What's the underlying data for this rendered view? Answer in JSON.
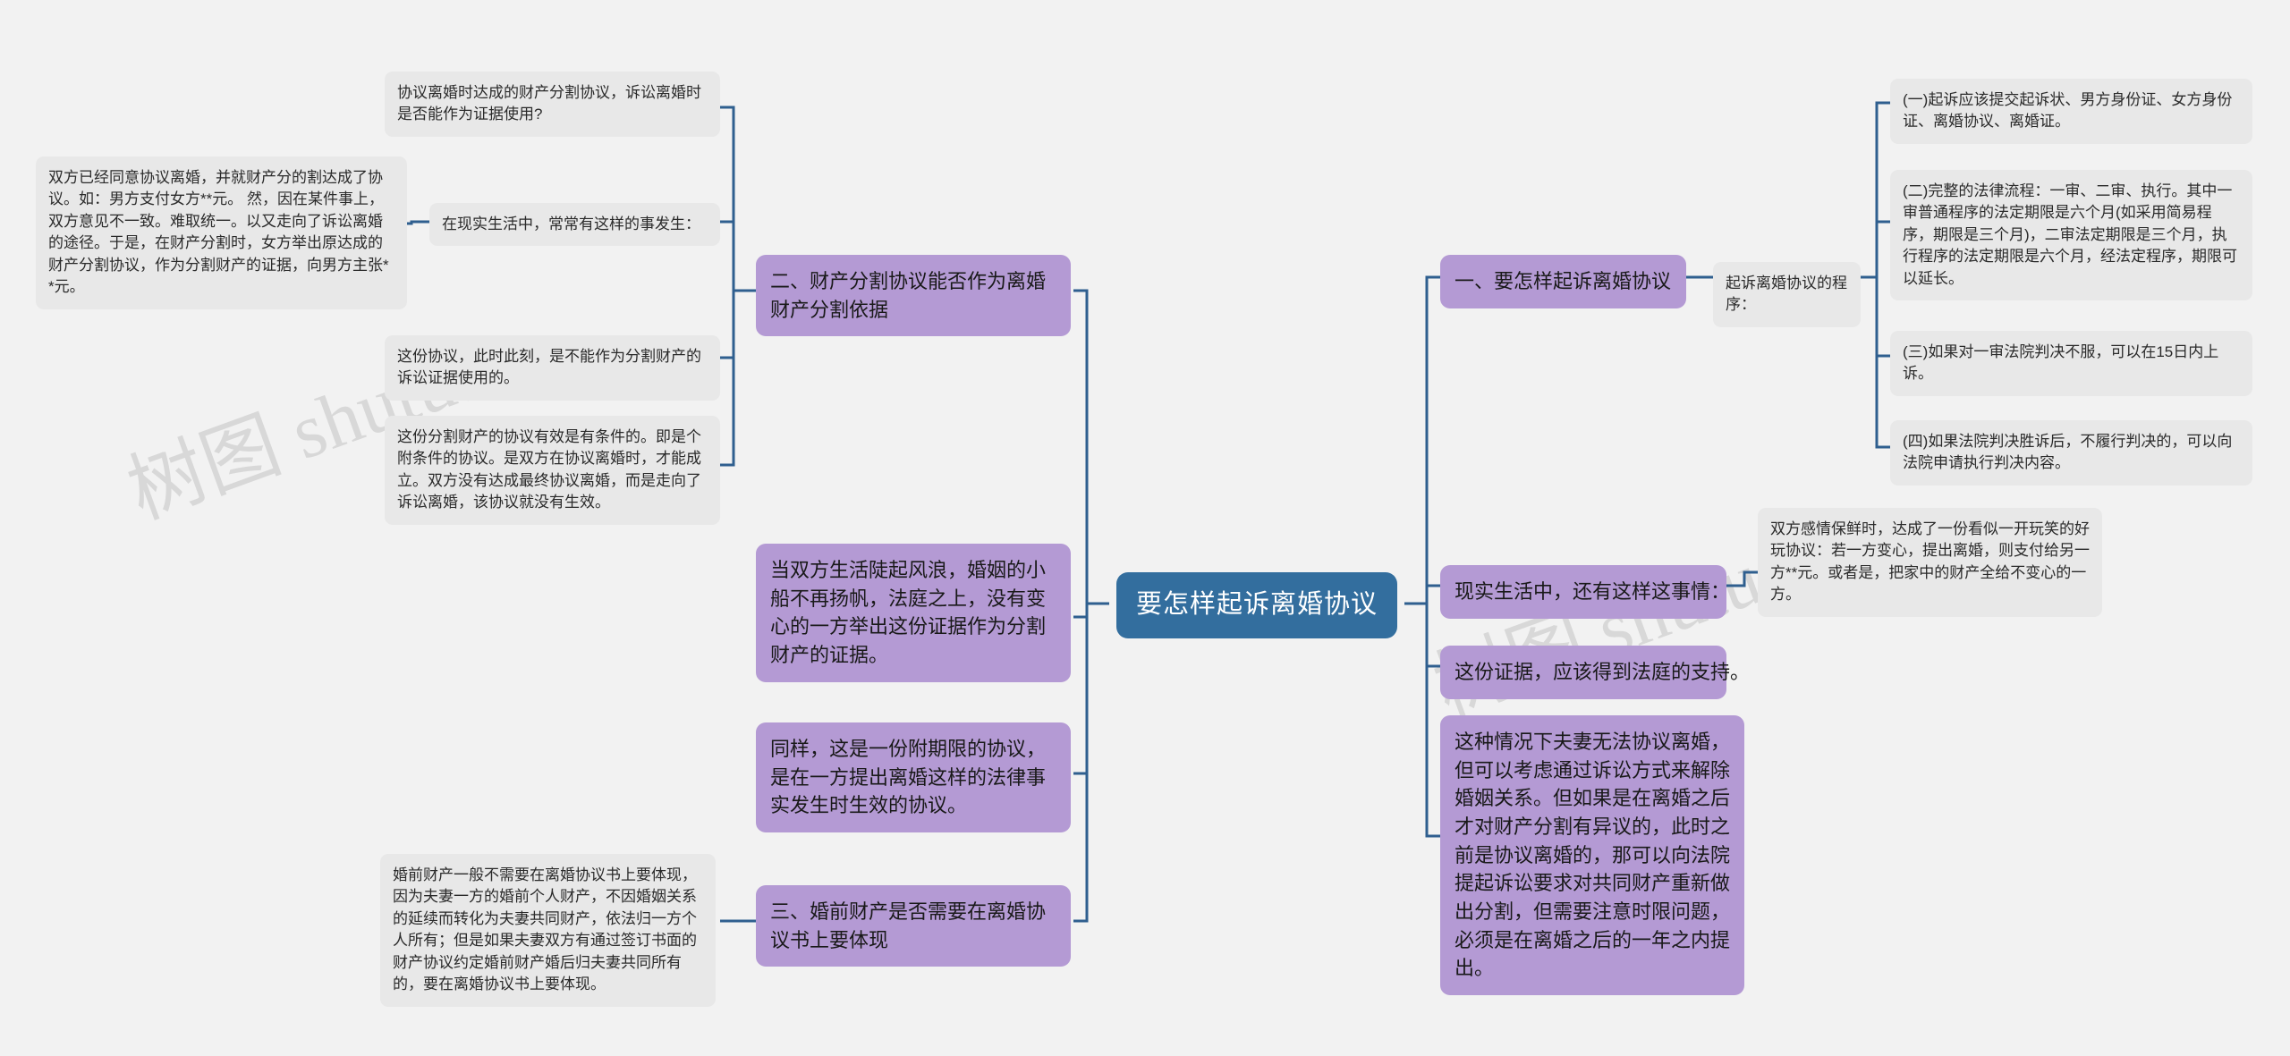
{
  "document": {
    "type": "mindmap",
    "title": "要怎样起诉离婚协议",
    "watermarks": [
      "树图 shutu.cn",
      "树图 shutu.cn"
    ],
    "colors": {
      "background": "#f2f2f2",
      "root_node": "#336e9e",
      "root_text": "#ffffff",
      "branch_node": "#b49ad4",
      "leaf_node": "#e8e8e8",
      "connector": "#2f5f8f",
      "watermark": "#d8d8d8"
    }
  },
  "root": {
    "label": "要怎样起诉离婚协议"
  },
  "left_branch": {
    "heading": "二、财产分割协议能否作为离婚财产分割依据",
    "children": [
      {
        "label": "协议离婚时达成的财产分割协议，诉讼离婚时是否能作为证据使用?"
      },
      {
        "label": "在现实生活中，常常有这样的事发生：",
        "detail": "双方已经同意协议离婚，并就财产分的割达成了协议。如：男方支付女方**元。 然，因在某件事上，双方意见不一致。难取统一。以又走向了诉讼离婚的途径。于是，在财产分割时，女方举出原达成的财产分割协议，作为分割财产的证据，向男方主张**元。"
      },
      {
        "label": "这份协议，此时此刻，是不能作为分割财产的诉讼证据使用的。"
      },
      {
        "label": "这份分割财产的协议有效是有条件的。即是个附条件的协议。是双方在协议离婚时，才能成立。双方没有达成最终协议离婚，而是走向了诉讼离婚，该协议就没有生效。"
      }
    ]
  },
  "left_mid_nodes": [
    {
      "label": "当双方生活陡起风浪，婚姻的小船不再扬帆，法庭之上，没有变心的一方举出这份证据作为分割财产的证据。"
    },
    {
      "label": "同样，这是一份附期限的协议，是在一方提出离婚这样的法律事实发生时生效的协议。"
    }
  ],
  "left_bottom_branch": {
    "heading": "三、婚前财产是否需要在离婚协议书上要体现",
    "detail": "婚前财产一般不需要在离婚协议书上要体现，因为夫妻一方的婚前个人财产，不因婚姻关系的延续而转化为夫妻共同财产，依法归一方个人所有；但是如果夫妻双方有通过签订书面的财产协议约定婚前财产婚后归夫妻共同所有的，要在离婚协议书上要体现。"
  },
  "right_branch": {
    "heading": "一、要怎样起诉离婚协议",
    "sub_label": "起诉离婚协议的程序：",
    "steps": [
      "(一)起诉应该提交起诉状、男方身份证、女方身份证、离婚协议、离婚证。",
      "(二)完整的法律流程：一审、二审、执行。其中一审普通程序的法定期限是六个月(如采用简易程序，期限是三个月)，二审法定期限是三个月，执行程序的法定期限是六个月，经法定程序，期限可以延长。",
      "(三)如果对一审法院判决不服，可以在15日内上诉。",
      "(四)如果法院判决胜诉后，不履行判决的，可以向法院申请执行判决内容。"
    ]
  },
  "right_mid": {
    "label": "现实生活中，还有这样这事情：",
    "detail": "双方感情保鲜时，达成了一份看似一开玩笑的好玩协议：若一方变心，提出离婚，则支付给另一方**元。或者是，把家中的财产全给不变心的一方。",
    "evidence_label": "这份证据，应该得到法庭的支持。"
  },
  "right_bottom": {
    "label": "这种情况下夫妻无法协议离婚，但可以考虑通过诉讼方式来解除婚姻关系。但如果是在离婚之后才对财产分割有异议的，此时之前是协议离婚的，那可以向法院提起诉讼要求对共同财产重新做出分割，但需要注意时限问题，必须是在离婚之后的一年之内提出。"
  }
}
